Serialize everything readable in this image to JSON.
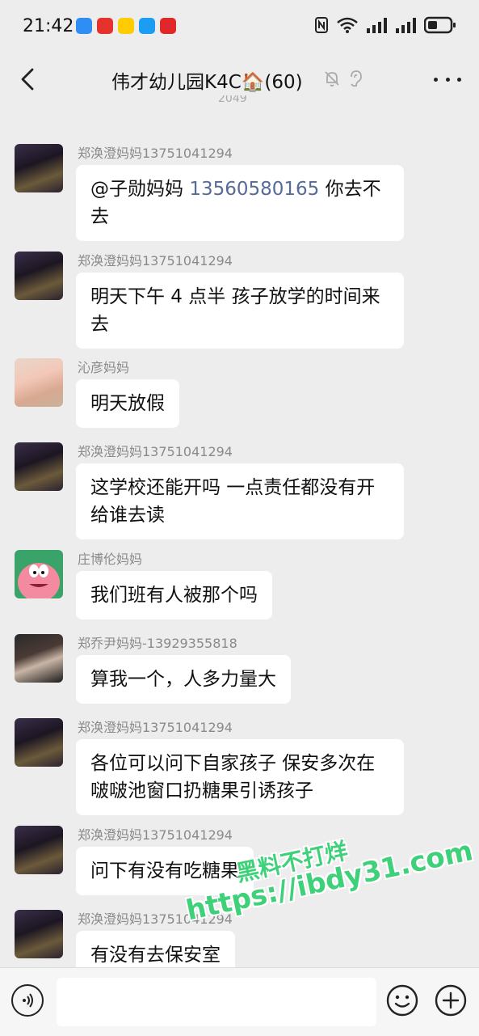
{
  "status_bar": {
    "time": "21:42",
    "notification_icons": [
      {
        "name": "chat-app-icon",
        "color": "#2f8ef4"
      },
      {
        "name": "red-app-icon",
        "color": "#e5322d"
      },
      {
        "name": "meituan-icon",
        "color": "#ffcc00"
      },
      {
        "name": "cloud-icon",
        "color": "#1a9df2"
      },
      {
        "name": "red-app-icon-2",
        "color": "#e02828"
      }
    ],
    "battery_icon": "battery-icon",
    "signal_icons": [
      "nfc-icon",
      "wifi-icon",
      "signal-icon",
      "signal-icon-2"
    ]
  },
  "header": {
    "title": "伟才幼儿园K4C🏠(60)",
    "icons": [
      "mute-icon",
      "ear-icon"
    ]
  },
  "partial_timestamp": "2049",
  "messages": [
    {
      "sender": "郑涣澄妈妈13751041294",
      "avatar": "avatar-night-city",
      "parts": [
        {
          "text": "@子勋妈妈 "
        },
        {
          "text": "13560580165",
          "link": true
        },
        {
          "text": " 你去不去"
        }
      ]
    },
    {
      "sender": "郑涣澄妈妈13751041294",
      "avatar": "avatar-night-city",
      "text": "明天下午 4 点半  孩子放学的时间来去"
    },
    {
      "sender": "沁彦妈妈",
      "avatar": "avatar-girls-photo",
      "text": "明天放假"
    },
    {
      "sender": "郑涣澄妈妈13751041294",
      "avatar": "avatar-night-city",
      "text": "这学校还能开吗  一点责任都没有开给谁去读"
    },
    {
      "sender": "庄博伦妈妈",
      "avatar": "avatar-patrick-star",
      "text": "我们班有人被那个吗"
    },
    {
      "sender": "郑乔尹妈妈-13929355818",
      "avatar": "avatar-woman-dark",
      "text": "算我一个，人多力量大"
    },
    {
      "sender": "郑涣澄妈妈13751041294",
      "avatar": "avatar-night-city",
      "text": "各位可以问下自家孩子 保安多次在啵啵池窗口扔糖果引诱孩子"
    },
    {
      "sender": "郑涣澄妈妈13751041294",
      "avatar": "avatar-night-city",
      "text": "问下有没有吃糖果"
    },
    {
      "sender": "郑涣澄妈妈13751041294",
      "avatar": "avatar-night-city",
      "text": "有没有去保安室"
    }
  ],
  "input_bar": {
    "placeholder": "",
    "voice_icon": "voice-icon",
    "emoji_icon": "emoji-icon",
    "plus_icon": "plus-icon"
  },
  "watermark": {
    "line1": "黑料不打烊",
    "line2": "https://ibdy31.com"
  }
}
